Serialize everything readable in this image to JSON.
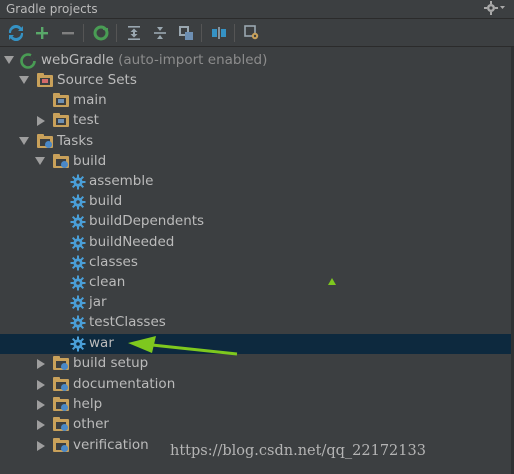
{
  "panel": {
    "title": "Gradle projects",
    "settings_icon": "gear-icon"
  },
  "toolbar": {
    "buttons": [
      {
        "icon": "refresh-icon",
        "color": "#3592c4"
      },
      {
        "icon": "add-icon",
        "color": "#59a869"
      },
      {
        "icon": "remove-icon",
        "color": "#808080"
      },
      {
        "icon": "execute-task-icon",
        "color": "#499c54"
      },
      {
        "icon": "expand-all-icon",
        "color": "#9aa7b0"
      },
      {
        "icon": "collapse-all-icon",
        "color": "#9aa7b0"
      },
      {
        "icon": "attach-icon",
        "color": "#9aa7b0"
      },
      {
        "icon": "toggle-offline-icon",
        "color": "#9aa7b0"
      },
      {
        "icon": "gradle-settings-icon",
        "color": "#9aa7b0"
      }
    ]
  },
  "tree": {
    "project": {
      "name": "webGradle",
      "note": "(auto-import enabled)"
    },
    "source_sets": {
      "label": "Source Sets",
      "items": [
        "main",
        "test"
      ]
    },
    "tasks": {
      "label": "Tasks",
      "build": {
        "label": "build",
        "items": [
          "assemble",
          "build",
          "buildDependents",
          "buildNeeded",
          "classes",
          "clean",
          "jar",
          "testClasses",
          "war"
        ]
      },
      "groups": [
        "build setup",
        "documentation",
        "help",
        "other",
        "verification"
      ]
    },
    "selected_task": "war"
  },
  "watermark": "https://blog.csdn.net/qq_22172133",
  "colors": {
    "background": "#3c3f41",
    "selection": "#0d293e",
    "annotation_arrow": "#7ec81e",
    "text": "#bbbbbb"
  }
}
